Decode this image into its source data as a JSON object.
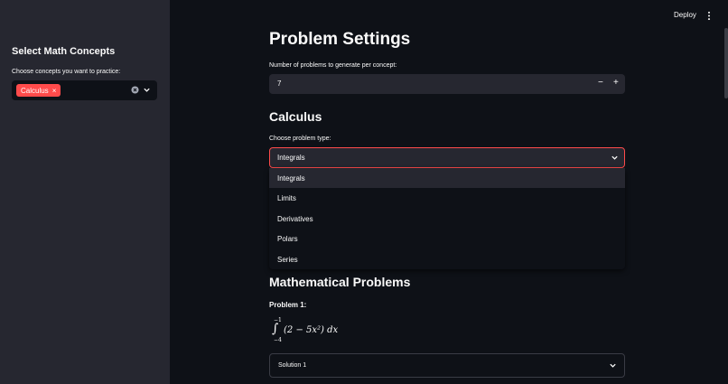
{
  "sidebar": {
    "heading": "Select Math Concepts",
    "concepts_label": "Choose concepts you want to practice:",
    "selected_chip": "Calculus",
    "chip_remove": "×"
  },
  "header": {
    "deploy_label": "Deploy"
  },
  "settings": {
    "title": "Problem Settings",
    "count_label": "Number of problems to generate per concept:",
    "count_value": "7",
    "minus": "−",
    "plus": "+"
  },
  "calculus": {
    "title": "Calculus",
    "type_label": "Choose problem type:",
    "selected_type": "Integrals",
    "options": [
      "Integrals",
      "Limits",
      "Derivatives",
      "Polars",
      "Series"
    ]
  },
  "problems": {
    "title": "Mathematical Problems",
    "problem1_label": "Problem 1:",
    "formula": {
      "upper": "−1",
      "lower": "−4",
      "sign": "∫",
      "integrand": "(2 − 5x²) dx"
    },
    "solution1_label": "Solution 1"
  },
  "colors": {
    "accent": "#ff4b4b",
    "background": "#0e1117",
    "panel": "#262730"
  }
}
